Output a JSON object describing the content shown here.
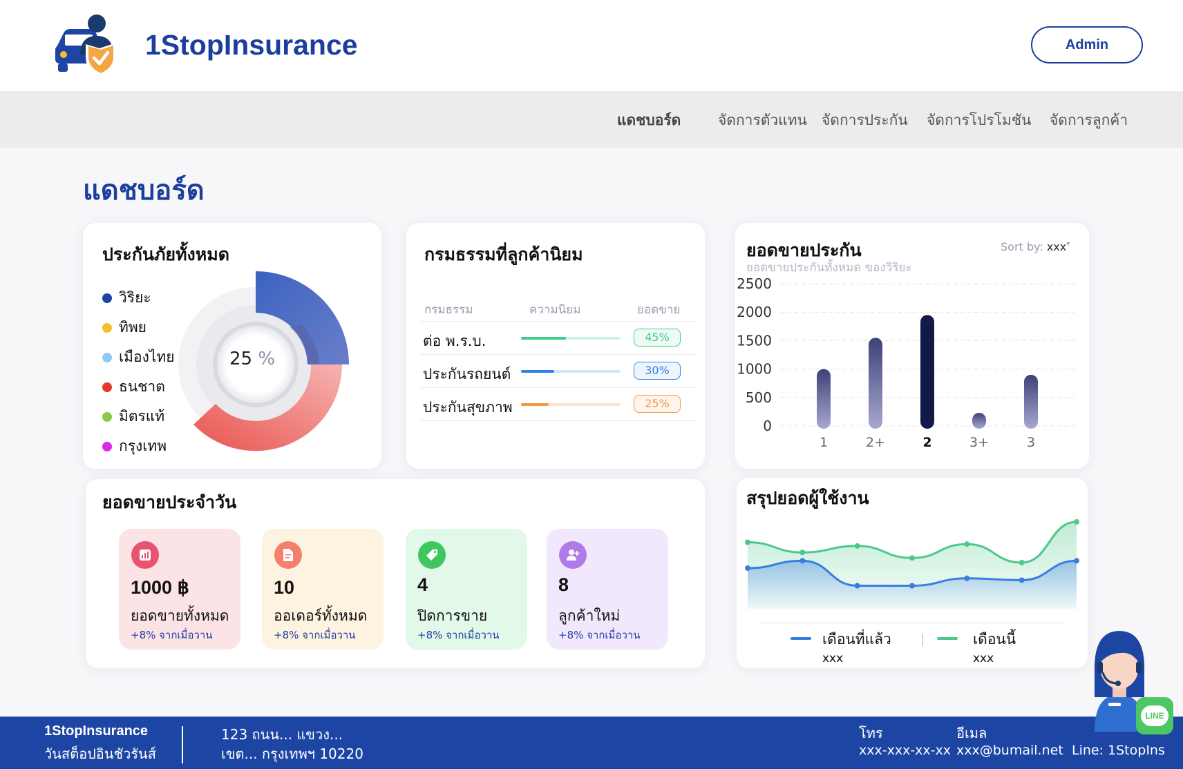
{
  "header": {
    "brand": "1StopInsurance",
    "admin_label": "Admin",
    "logo_icon": "car-user-shield-icon"
  },
  "nav": {
    "items": [
      {
        "label": "แดชบอร์ด",
        "active": true
      },
      {
        "label": "จัดการตัวแทน",
        "active": false
      },
      {
        "label": "จัดการประกัน",
        "active": false
      },
      {
        "label": "จัดการโปรโมชัน",
        "active": false
      },
      {
        "label": "จัดการลูกค้า",
        "active": false
      }
    ]
  },
  "page_title": "แดชบอร์ด",
  "insurance_card": {
    "title": "ประกันภัยทั้งหมด",
    "legend": [
      {
        "label": "วิริยะ",
        "color": "#1d45a4"
      },
      {
        "label": "ทิพย",
        "color": "#f3c02e"
      },
      {
        "label": "เมืองไทย",
        "color": "#8ccaf3"
      },
      {
        "label": "ธนชาต",
        "color": "#e33a2a"
      },
      {
        "label": "มิตรแท้",
        "color": "#8bc64a"
      },
      {
        "label": "กรุงเทพ",
        "color": "#d92be6"
      }
    ],
    "donut_value": "25",
    "donut_unit": "%"
  },
  "popular_card": {
    "title": "กรมธรรมที่ลูกค้านิยม",
    "headers": [
      "กรมธรรม",
      "ความนิยม",
      "ยอดขาย"
    ],
    "rows": [
      {
        "name": "ต่อ พ.ร.บ.",
        "popularity": 0.45,
        "sales": "45%",
        "color": "#3fce8a",
        "track": "#cdf3e0"
      },
      {
        "name": "ประกันรถยนต์",
        "popularity": 0.3,
        "sales": "30%",
        "color": "#2f80ed",
        "track": "#d2e6fb"
      },
      {
        "name": "ประกันสุขภาพ",
        "popularity": 0.25,
        "sales": "25%",
        "color": "#f2994a",
        "track": "#fbe2cc"
      }
    ]
  },
  "sales_card": {
    "title": "ยอดขายประกัน",
    "subtitle": "ยอดขายประกันทั้งหมด ของวิริยะ",
    "sort_label": "Sort by:",
    "sort_value": "xxx",
    "chart_data": {
      "type": "bar",
      "categories": [
        "1",
        "2+",
        "2",
        "3+",
        "3"
      ],
      "values": [
        1000,
        1550,
        1950,
        230,
        900
      ],
      "highlight_index": 2,
      "yticks": [
        0,
        500,
        1000,
        1500,
        2000,
        2500
      ],
      "ylim": [
        0,
        2500
      ],
      "grid": true
    }
  },
  "daily_card": {
    "title": "ยอดขายประจำวัน",
    "stats": [
      {
        "value": "1000 ฿",
        "label": "ยอดขายทั้งหมด",
        "change": "+8% จากเมื่อวาน",
        "bg": "#fbe3e6",
        "icon_bg": "#e8546f",
        "icon": "bar-chart-icon"
      },
      {
        "value": "10",
        "label": "ออเดอร์ทั้งหมด",
        "change": "+8% จากเมื่อวาน",
        "bg": "#fdf3e0",
        "icon_bg": "#f57f6b",
        "icon": "document-icon"
      },
      {
        "value": "4",
        "label": "ปิดการขาย",
        "change": "+8% จากเมื่อวาน",
        "bg": "#e2f8e9",
        "icon_bg": "#3fc75e",
        "icon": "tag-icon"
      },
      {
        "value": "8",
        "label": "ลูกค้าใหม่",
        "change": "+8% จากเมื่อวาน",
        "bg": "#f1e8fd",
        "icon_bg": "#b17ae9",
        "icon": "add-user-icon"
      }
    ]
  },
  "users_card": {
    "title": "สรุปยอดผู้ใช้งาน",
    "legend": [
      {
        "label": "เดือนที่แล้ว",
        "value": "xxx",
        "color": "#3a7de0"
      },
      {
        "label": "เดือนนี้",
        "value": "xxx",
        "color": "#4cc98a"
      }
    ],
    "chart_data": {
      "type": "area",
      "x": [
        0,
        1,
        2,
        3,
        4,
        5,
        6
      ],
      "series": [
        {
          "name": "เดือนที่แล้ว",
          "values": [
            44,
            52,
            25,
            25,
            33,
            31,
            52
          ],
          "color": "#3a7de0"
        },
        {
          "name": "เดือนนี้",
          "values": [
            72,
            61,
            68,
            55,
            70,
            50,
            94
          ],
          "color": "#4cc98a"
        }
      ],
      "ylim": [
        0,
        100
      ]
    }
  },
  "footer": {
    "brand": "1StopInsurance",
    "brand_th": "วันสต็อปอินชัวรันส์",
    "address_line1": "123 ถนน... แขวง...",
    "address_line2": "เขต... กรุงเทพฯ 10220",
    "phone_label": "โทร",
    "phone": "xxx-xxx-xx-xx",
    "email_label": "อีเมล",
    "email": "xxx@bumail.net",
    "line": "Line: 1StopIns"
  },
  "support": {
    "badge": "LINE",
    "icon": "support-agent-icon"
  }
}
